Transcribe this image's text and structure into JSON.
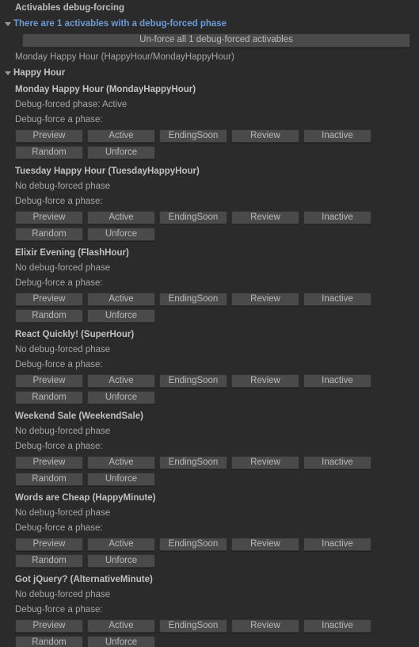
{
  "panel": {
    "title": "Activables debug-forcing",
    "summary_foldout": {
      "label": "There are 1 activables with a debug-forced phase",
      "expanded": true,
      "triangle_icon": "triangle-down-icon",
      "unforce_all_button": "Un-force all 1 debug-forced activables",
      "forced_list": [
        "Monday Happy Hour (HappyHour/MondayHappyHour)"
      ]
    },
    "group": {
      "label": "Happy Hour",
      "expanded": true,
      "triangle_icon": "triangle-down-icon"
    },
    "labels": {
      "forced_phase_prefix": "Debug-forced phase: ",
      "no_forced_phase": "No debug-forced phase",
      "force_prompt": "Debug-force a phase:"
    },
    "phase_buttons_row1": [
      "Preview",
      "Active",
      "EndingSoon",
      "Review",
      "Inactive"
    ],
    "phase_buttons_row2": [
      "Random",
      "Unforce"
    ],
    "activables": [
      {
        "title": "Monday Happy Hour (MondayHappyHour)",
        "status": "Debug-forced phase: Active",
        "forced": true,
        "forced_phase": "Active"
      },
      {
        "title": "Tuesday Happy Hour (TuesdayHappyHour)",
        "status": "No debug-forced phase",
        "forced": false,
        "forced_phase": ""
      },
      {
        "title": "Elixir Evening (FlashHour)",
        "status": "No debug-forced phase",
        "forced": false,
        "forced_phase": ""
      },
      {
        "title": "React Quickly! (SuperHour)",
        "status": "No debug-forced phase",
        "forced": false,
        "forced_phase": ""
      },
      {
        "title": "Weekend Sale (WeekendSale)",
        "status": "No debug-forced phase",
        "forced": false,
        "forced_phase": ""
      },
      {
        "title": "Words are Cheap (HappyMinute)",
        "status": "No debug-forced phase",
        "forced": false,
        "forced_phase": ""
      },
      {
        "title": "Got jQuery? (AlternativeMinute)",
        "status": "No debug-forced phase",
        "forced": false,
        "forced_phase": ""
      }
    ],
    "colors": {
      "background": "#2b2b2b",
      "text": "#b4b4b4",
      "link": "#6c9bd8",
      "button_face": "#4a4a4a",
      "button_border": "#303030"
    }
  }
}
